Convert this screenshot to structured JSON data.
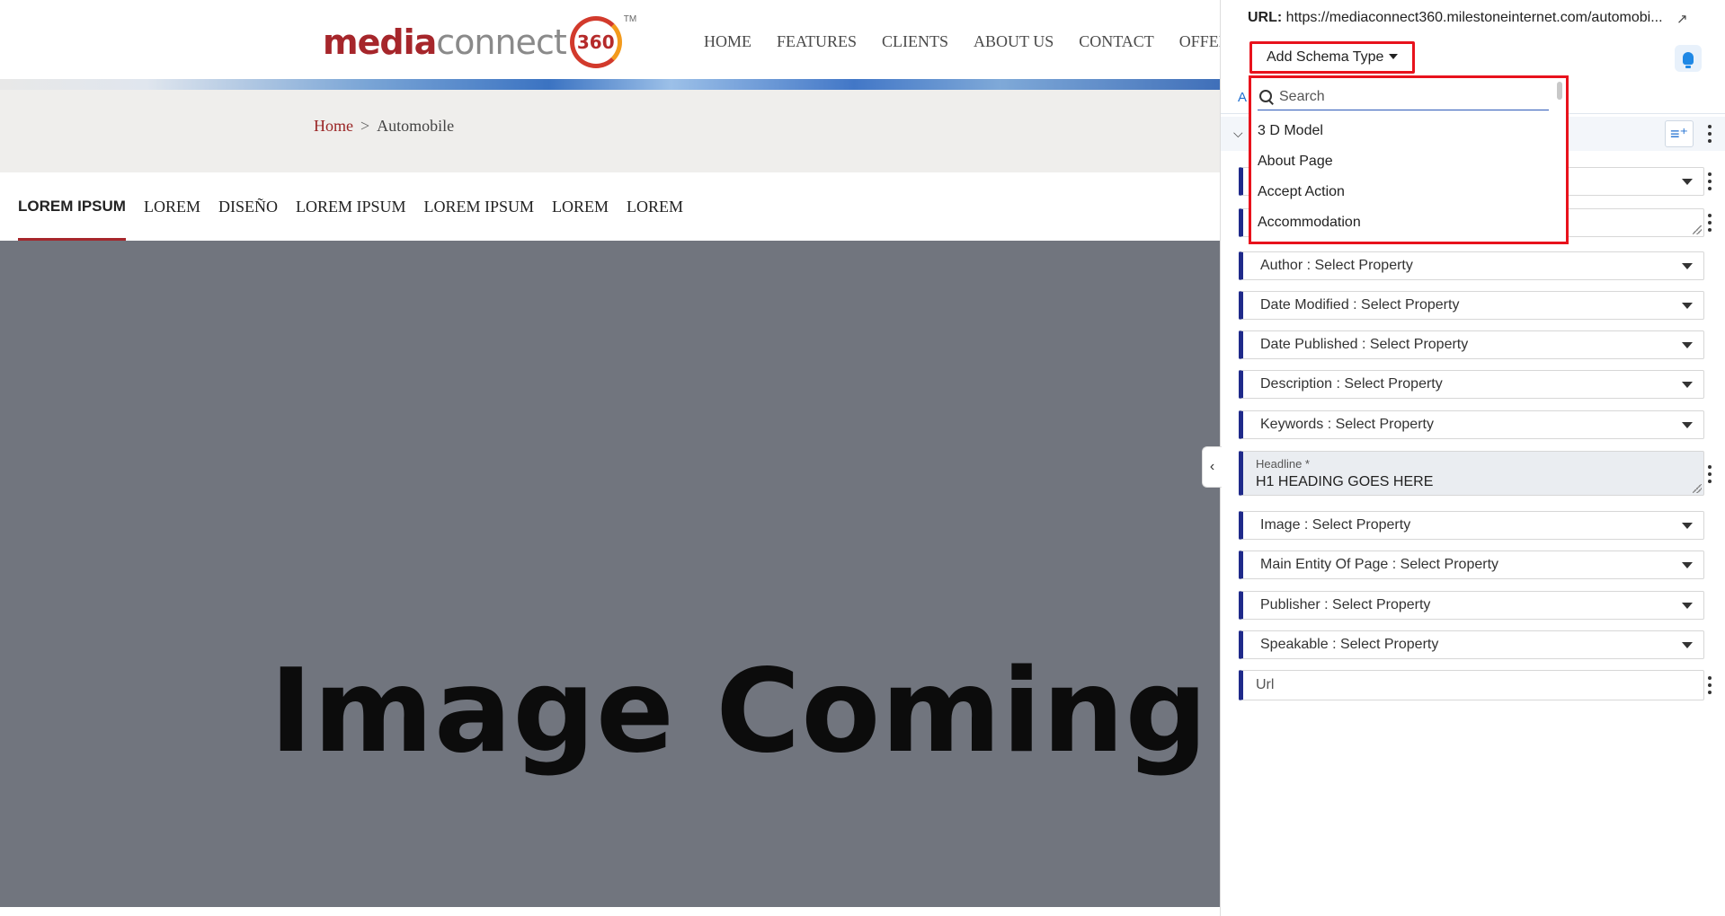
{
  "site": {
    "logo": {
      "word1": "media",
      "word2": "connect",
      "badge": "360",
      "tm": "TM"
    },
    "nav": [
      "HOME",
      "FEATURES",
      "CLIENTS",
      "ABOUT US",
      "CONTACT",
      "OFFER"
    ],
    "breadcrumb": {
      "home": "Home",
      "sep": ">",
      "current": "Automobile"
    },
    "sub_tabs": [
      "LOREM IPSUM",
      "LOREM",
      "DISEÑO",
      "LOREM IPSUM",
      "LOREM IPSUM",
      "LOREM",
      "LOREM"
    ],
    "hero_text": "Image Coming S"
  },
  "panel": {
    "url_label": "URL:",
    "url_value": "https://mediaconnect360.milestoneinternet.com/automobi...",
    "add_schema_label": "Add Schema Type",
    "tab_peek": "A",
    "dropdown": {
      "search_placeholder": "Search",
      "options": [
        "3 D Model",
        "About Page",
        "Accept Action",
        "Accommodation"
      ]
    },
    "properties": [
      "Author : Select Property",
      "Date Modified : Select Property",
      "Date Published : Select Property",
      "Description : Select Property",
      "Keywords : Select Property"
    ],
    "headline": {
      "label": "Headline *",
      "value": "H1 HEADING GOES HERE"
    },
    "properties_after": [
      "Image : Select Property",
      "Main Entity Of Page : Select Property",
      "Publisher : Select Property",
      "Speakable : Select Property"
    ],
    "url_field_value": "Url"
  },
  "colors": {
    "brand_red": "#a6262b",
    "highlight_red": "#e8121c",
    "accent_blue": "#1f2a8a",
    "hero_gray": "#71757e"
  }
}
